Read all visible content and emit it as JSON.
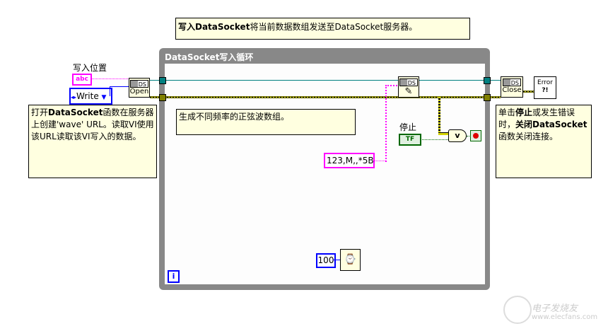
{
  "top_comment": {
    "bold": "写入DataSocket",
    "text": "将当前数据数组发送至DataSocket服务器。"
  },
  "loop": {
    "title": "DataSocket写入循环",
    "iteration_label": "i"
  },
  "location_label": "写入位置",
  "abc_constant": "abc",
  "mode_enum": "Write",
  "open_node": {
    "tag": "DS",
    "label": "Open"
  },
  "write_node": {
    "tag": "DS",
    "label": "✎"
  },
  "close_node": {
    "tag": "DS",
    "label": "Close"
  },
  "error_node": {
    "line1": "Error",
    "line2": "?!"
  },
  "left_comment": {
    "p1": "打开",
    "bold": "DataSocket",
    "p2": "函数在服务器上创建'wave' URL。读取VI使用该URL读取该VI写入的数据。"
  },
  "inner_comment": "生成不同频率的正弦波数组。",
  "format_constant": "123,M,,*5B",
  "stop_label": "停止",
  "stop_control": "TF",
  "or_gate": "v",
  "right_comment": {
    "p1": "单击",
    "b1": "停止",
    "p2": "或发生错误时，",
    "b2": "关闭DataSocket",
    "p3": "函数关闭连接。"
  },
  "wait_constant": "100",
  "watermark": {
    "cn": "电子发烧友",
    "url": "www.elecfans.com"
  }
}
